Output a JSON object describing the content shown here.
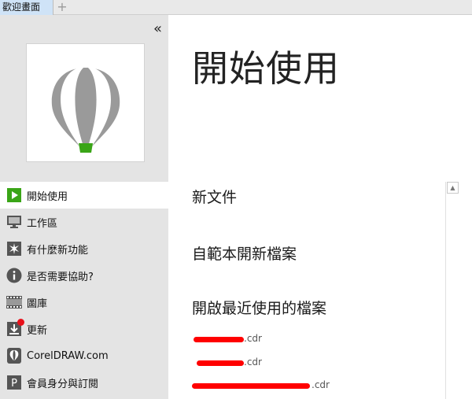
{
  "tabs": [
    {
      "label": "歡迎畫面"
    }
  ],
  "tab_add_glyph": "+",
  "sidebar": {
    "collapse_glyph": "«",
    "items": [
      {
        "label": "開始使用",
        "icon": "play-icon",
        "active": true
      },
      {
        "label": "工作區",
        "icon": "monitor-icon",
        "active": false
      },
      {
        "label": "有什麼新功能",
        "icon": "star-burst-icon",
        "active": false
      },
      {
        "label": "是否需要協助?",
        "icon": "info-icon",
        "active": false
      },
      {
        "label": "圖庫",
        "icon": "film-strip-icon",
        "active": false
      },
      {
        "label": "更新",
        "icon": "download-icon",
        "active": false
      },
      {
        "label": "CorelDRAW.com",
        "icon": "balloon-icon",
        "active": false
      },
      {
        "label": "會員身分與訂閱",
        "icon": "p-letter-icon",
        "active": false
      }
    ]
  },
  "main": {
    "title": "開始使用",
    "new_document": "新文件",
    "new_from_template": "自範本開新檔案",
    "open_recent": "開啟最近使用的檔案",
    "recent_files": [
      {
        "name": ".cdr"
      },
      {
        "name": ".cdr"
      },
      {
        "name": ".cdr"
      }
    ]
  },
  "colors": {
    "accent_green": "#3aa517",
    "sidebar_bg": "#e4e4e4",
    "redaction": "#ff0000",
    "tab_active": "#cfe3f7"
  }
}
